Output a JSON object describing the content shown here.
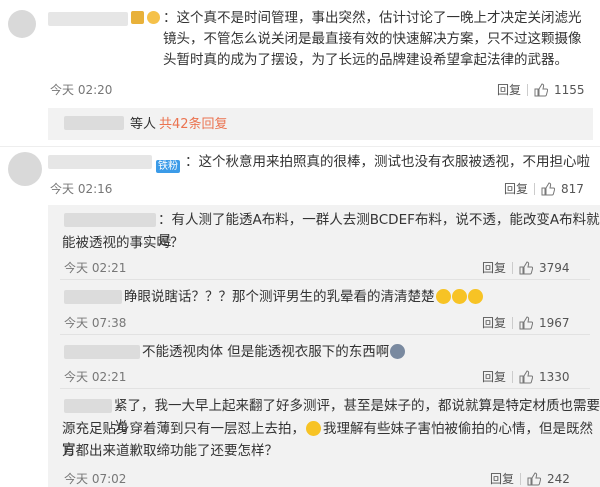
{
  "comments": [
    {
      "text": "：这个真不是时间管理，事出突然，估计讨论了一晚上才决定关闭滤光镜头，不管怎么说关闭是最直接有效的快速解决方案，只不过这颗摄像头暂时真的成为了摆设，为了长远的品牌建设希望拿起法律的武器。",
      "time": "今天 02:20",
      "reply": "回复",
      "likes": "1155"
    },
    {
      "replies_prefix": "等人",
      "replies_link": "共42条回复"
    },
    {
      "badge": "铁粉",
      "text": "：这个秋意用来拍照真的很棒，测试也没有衣服被透视，不用担心啦",
      "time": "今天 02:16",
      "reply": "回复",
      "likes": "817"
    }
  ],
  "sub_replies": [
    {
      "line1": "：有人测了能透A布料，一群人去测BCDEF布料，说不透，能改变A布料就是",
      "line2": "能被透视的事实吗？",
      "time": "今天 02:21",
      "reply": "回复",
      "likes": "3794"
    },
    {
      "line1": "睁眼说瞎话？？？那个测评男生的乳晕看的清清楚楚",
      "time": "今天 07:38",
      "reply": "回复",
      "likes": "1967"
    },
    {
      "line1": "不能透视肉体 但是能透视衣服下的东西啊",
      "time": "今天 02:21",
      "reply": "回复",
      "likes": "1330"
    },
    {
      "line1": "紧了，我一大早上起来翻了好多测评，甚至是妹子的，都说就算是特定材质也需要光",
      "line2": "源充足贴身穿着薄到只有一层怼上去拍，",
      "line2b": "我理解有些妹子害怕被偷拍的心情，但是既然官",
      "line3": "方都出来道歉取缔功能了还要怎样？",
      "time": "今天 07:02",
      "reply": "回复",
      "likes": "242"
    }
  ],
  "colors": {
    "accent": "#eb7350",
    "link": "#eb7350",
    "panel": "#f2f2f2"
  }
}
